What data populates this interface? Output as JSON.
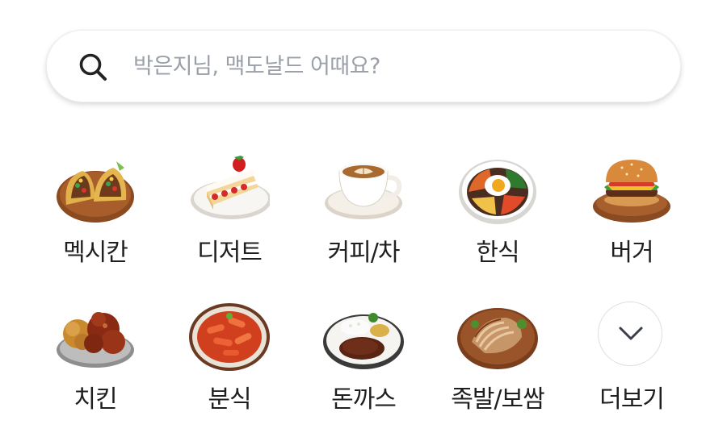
{
  "search": {
    "placeholder": "박은지님, 맥도날드 어때요?",
    "icon": "search-icon"
  },
  "categories": [
    {
      "label": "멕시칸",
      "icon": "taco-icon"
    },
    {
      "label": "디저트",
      "icon": "cake-icon"
    },
    {
      "label": "커피/차",
      "icon": "coffee-icon"
    },
    {
      "label": "한식",
      "icon": "bibimbap-icon"
    },
    {
      "label": "버거",
      "icon": "burger-icon"
    },
    {
      "label": "치킨",
      "icon": "fried-chicken-icon"
    },
    {
      "label": "분식",
      "icon": "tteokbokki-icon"
    },
    {
      "label": "돈까스",
      "icon": "pork-cutlet-icon"
    },
    {
      "label": "족발/보쌈",
      "icon": "jokbal-icon"
    }
  ],
  "more": {
    "label": "더보기",
    "icon": "chevron-down-icon"
  }
}
